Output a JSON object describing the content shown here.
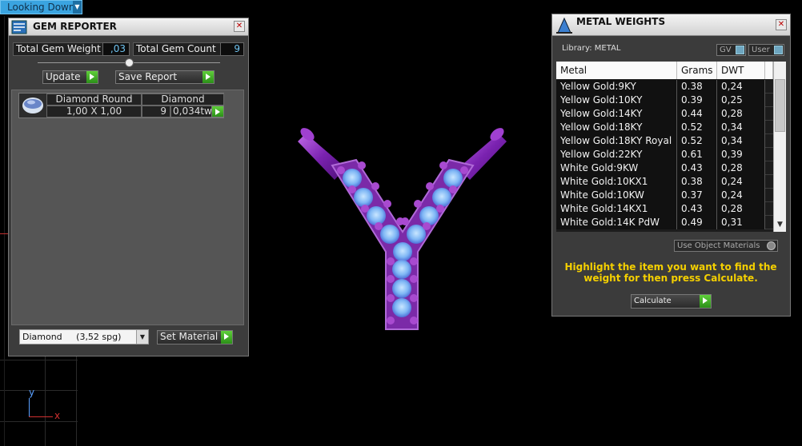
{
  "view": {
    "label": "Looking Down"
  },
  "gem_reporter": {
    "title": "GEM REPORTER",
    "total_weight_label": "Total Gem Weight",
    "total_weight_value": ",03",
    "total_count_label": "Total Gem Count",
    "total_count_value": "9",
    "update_label": "Update",
    "save_report_label": "Save Report",
    "gem": {
      "name": "Diamond Round",
      "size": "1,00 X 1,00",
      "material": "Diamond",
      "count": "9",
      "weight": "0,034tw"
    },
    "material_select": "Diamond     (3,52 spg)",
    "set_material_label": "Set Material"
  },
  "metal_weights": {
    "title": "METAL WEIGHTS",
    "library": "Library: METAL",
    "gv_label": "GV",
    "user_label": "User",
    "columns": [
      "Metal",
      "Grams",
      "DWT"
    ],
    "rows": [
      [
        "Yellow Gold:9KY",
        "0.38",
        "0,24"
      ],
      [
        "Yellow Gold:10KY",
        "0.39",
        "0,25"
      ],
      [
        "Yellow Gold:14KY",
        "0.44",
        "0,28"
      ],
      [
        "Yellow Gold:18KY",
        "0.52",
        "0,34"
      ],
      [
        "Yellow Gold:18KY Royal",
        "0.52",
        "0,34"
      ],
      [
        "Yellow Gold:22KY",
        "0.61",
        "0,39"
      ],
      [
        "White Gold:9KW",
        "0.43",
        "0,28"
      ],
      [
        "White Gold:10KX1",
        "0.38",
        "0,24"
      ],
      [
        "White Gold:10KW",
        "0.37",
        "0,24"
      ],
      [
        "White Gold:14KX1",
        "0.43",
        "0,28"
      ],
      [
        "White Gold:14K PdW",
        "0.49",
        "0,31"
      ]
    ],
    "use_object_label": "Use Object Materials",
    "instruction": "Highlight the item you want to find the weight for then press Calculate.",
    "calculate_label": "Calculate"
  },
  "colors": {
    "accent": "#3aa4e0",
    "go_green": "#3fae22",
    "instruction": "#f5d000",
    "purple": "#8a2bb8",
    "gem_blue": "#8fc8ff"
  },
  "axes": {
    "y": "y",
    "x": "x"
  }
}
